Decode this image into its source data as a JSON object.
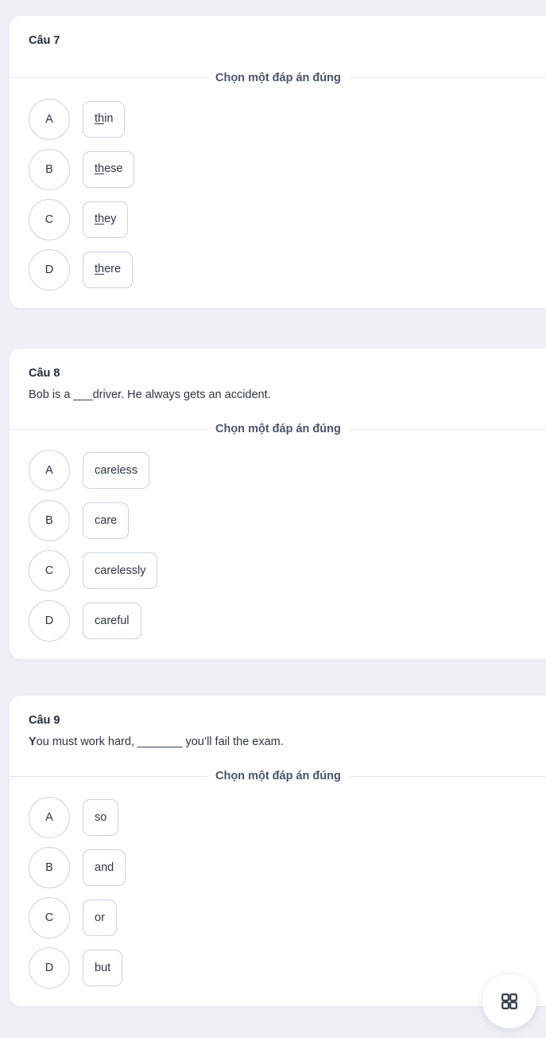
{
  "theme": {
    "page_background": "#eef0f5",
    "card_background": "#ffffff",
    "text_color": "#2b3544",
    "border_color": "#ccd3de",
    "divider_color": "#e4e7ee"
  },
  "choose_label": "Chọn một đáp án đúng",
  "questions": [
    {
      "title": "Câu 7",
      "text": "",
      "lead_bold": "",
      "options": [
        {
          "letter": "A",
          "underlined": "th",
          "rest": "in"
        },
        {
          "letter": "B",
          "underlined": "th",
          "rest": "ese"
        },
        {
          "letter": "C",
          "underlined": "th",
          "rest": "ey"
        },
        {
          "letter": "D",
          "underlined": "th",
          "rest": "ere"
        }
      ]
    },
    {
      "title": "Câu 8",
      "lead_bold": "",
      "text": "Bob is a ___driver. He always gets an accident.",
      "options": [
        {
          "letter": "A",
          "underlined": "",
          "rest": "careless"
        },
        {
          "letter": "B",
          "underlined": "",
          "rest": "care"
        },
        {
          "letter": "C",
          "underlined": "",
          "rest": "carelessly"
        },
        {
          "letter": "D",
          "underlined": "",
          "rest": "careful"
        }
      ]
    },
    {
      "title": "Câu 9",
      "lead_bold": "Y",
      "text": "ou must work hard, _______ you’ll fail the exam.",
      "options": [
        {
          "letter": "A",
          "underlined": "",
          "rest": "so"
        },
        {
          "letter": "B",
          "underlined": "",
          "rest": "and"
        },
        {
          "letter": "C",
          "underlined": "",
          "rest": "or"
        },
        {
          "letter": "D",
          "underlined": "",
          "rest": "but"
        }
      ]
    }
  ],
  "fab": {
    "icon": "grid-2x2-icon",
    "label": ""
  }
}
